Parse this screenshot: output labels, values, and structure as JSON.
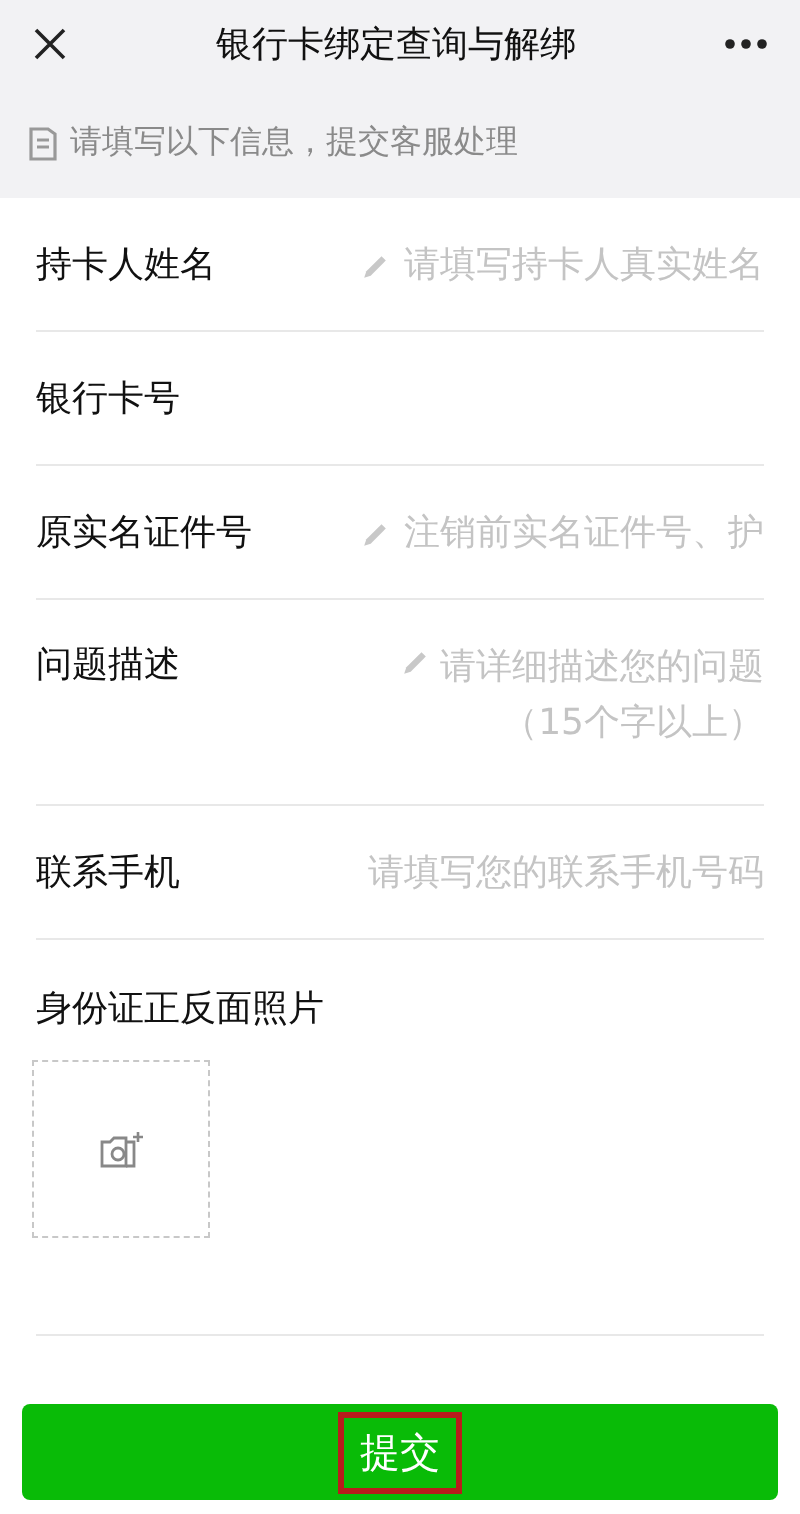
{
  "header": {
    "title": "银行卡绑定查询与解绑"
  },
  "notice": "请填写以下信息，提交客服处理",
  "fields": [
    {
      "kind": "line",
      "label": "持卡人姓名",
      "placeholder": "请填写持卡人真实姓名",
      "pencil": true
    },
    {
      "kind": "line",
      "label": "银行卡号",
      "pencil": false
    },
    {
      "kind": "line",
      "label": "原实名证件号",
      "placeholder": "注销前实名证件号、护",
      "pencil": true
    },
    {
      "kind": "multiline",
      "label": "问题描述",
      "placeholder": "请详细描述您的问题（15个字以上）",
      "pencil": true
    },
    {
      "kind": "line",
      "label": "联系手机",
      "placeholder": "请填写您的联系手机号码",
      "pencil": false
    },
    {
      "kind": "photo",
      "label": "身份证正反面照片"
    }
  ],
  "submit": {
    "label": "提交",
    "highlighted": true
  }
}
